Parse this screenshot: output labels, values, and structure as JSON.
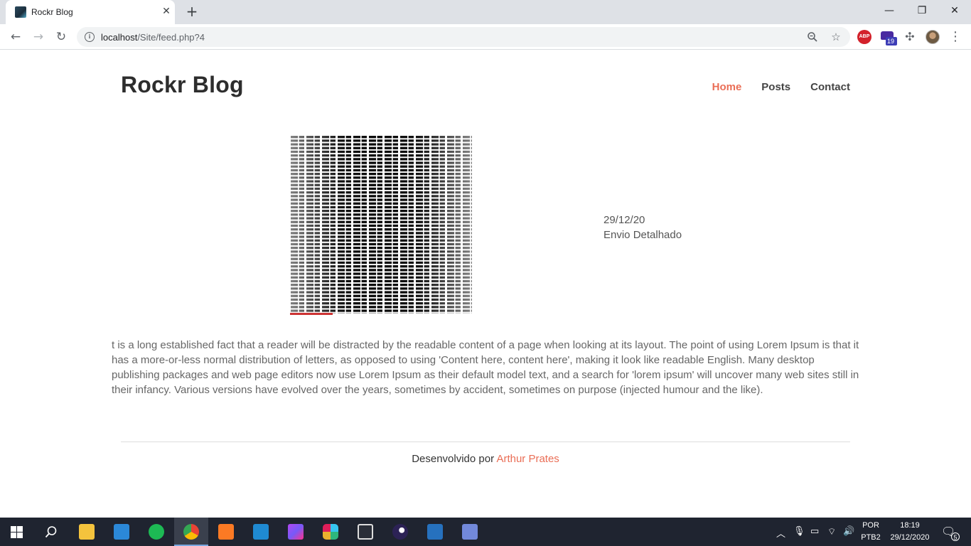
{
  "browser": {
    "tab_title": "Rockr Blog",
    "tab_close": "✕",
    "new_tab": "+",
    "url_host": "localhost",
    "url_path": "/Site/feed.php?4",
    "extension_badge": "19",
    "abp_label": "ABP",
    "window_controls": {
      "minimize": "—",
      "restore": "❐",
      "close": "✕"
    }
  },
  "site": {
    "brand": "Rockr Blog",
    "nav": [
      {
        "label": "Home",
        "active": true
      },
      {
        "label": "Posts",
        "active": false
      },
      {
        "label": "Contact",
        "active": false
      }
    ]
  },
  "post": {
    "date": "29/12/20",
    "title": "Envio Detalhado",
    "body": "t is a long established fact that a reader will be distracted by the readable content of a page when looking at its layout. The point of using Lorem Ipsum is that it has a more-or-less normal distribution of letters, as opposed to using 'Content here, content here', making it look like readable English. Many desktop publishing packages and web page editors now use Lorem Ipsum as their default model text, and a search for 'lorem ipsum' will uncover many web sites still in their infancy. Various versions have evolved over the years, sometimes by accident, sometimes on purpose (injected humour and the like)."
  },
  "footer": {
    "prefix": "Desenvolvido por ",
    "author": "Arthur Prates"
  },
  "colors": {
    "accent": "#ea6e56",
    "taskbar": "#1f2430"
  },
  "taskbar": {
    "language_top": "POR",
    "language_bottom": "PTB2",
    "time": "18:19",
    "date": "29/12/2020",
    "notifications": "5",
    "apps": [
      "file-explorer",
      "mail",
      "spotify",
      "chrome",
      "xampp",
      "vscode",
      "phpstorm",
      "slack",
      "media-player",
      "eclipse",
      "powershell",
      "discord"
    ]
  }
}
